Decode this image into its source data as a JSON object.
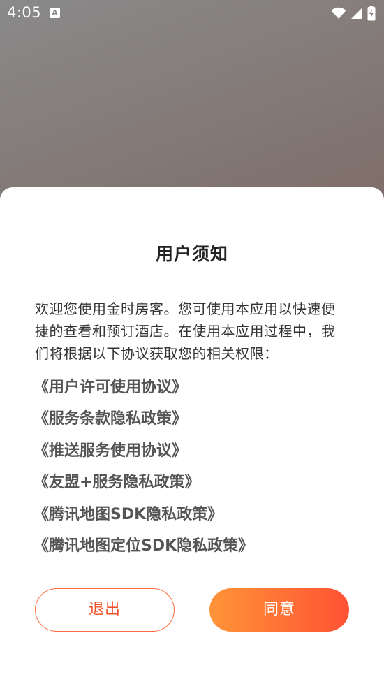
{
  "status_bar": {
    "time": "4:05",
    "app_icon_letter": "A",
    "icons": [
      "wifi-icon",
      "cell-signal-icon",
      "battery-charging-icon"
    ]
  },
  "dialog": {
    "title": "用户须知",
    "intro": "欢迎您使用金时房客。您可使用本应用以快速便捷的查看和预订酒店。在使用本应用过程中，我们将根据以下协议获取您的相关权限：",
    "agreements": [
      "《用户许可使用协议》",
      "《服务条款隐私政策》",
      "《推送服务使用协议》",
      "《友盟+服务隐私政策》",
      "《腾讯地图SDK隐私政策》",
      "《腾讯地图定位SDK隐私政策》"
    ],
    "exit_label": "退出",
    "agree_label": "同意"
  },
  "colors": {
    "accent_start": "#ff9438",
    "accent_end": "#ff5233",
    "exit_text": "#f0522e"
  }
}
